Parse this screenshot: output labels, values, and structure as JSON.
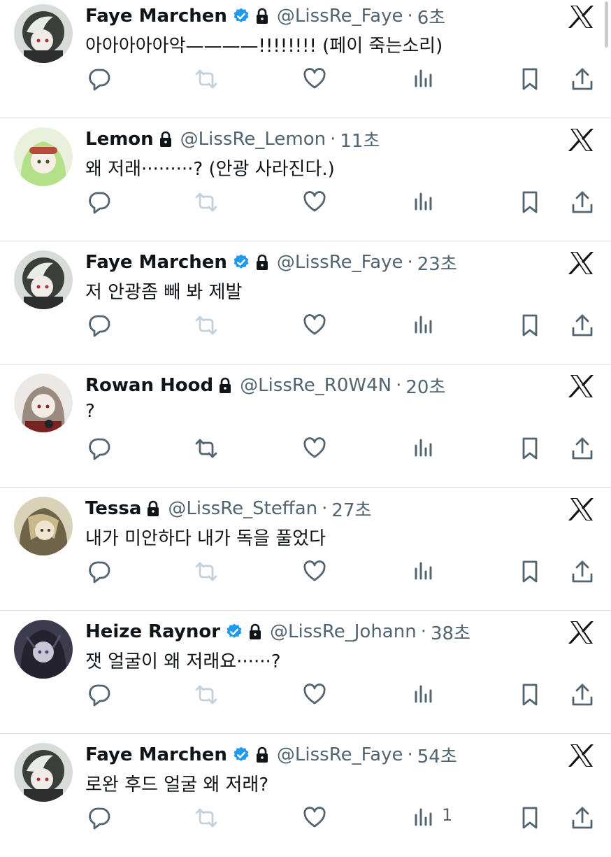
{
  "colors": {
    "verified": "#1d9bf0",
    "muted": "#536471",
    "text": "#0f1419",
    "disabled_icon": "#c6d0d8",
    "divider": "#dcdfe2"
  },
  "icons": {
    "reply": "reply-icon",
    "retweet": "retweet-icon",
    "like": "heart-icon",
    "views": "views-icon",
    "bookmark": "bookmark-icon",
    "share": "share-icon",
    "platform": "x-logo-icon",
    "lock": "lock-icon",
    "verified": "verified-badge-icon"
  },
  "tweets": [
    {
      "name": "Faye Marchen",
      "verified": true,
      "locked": true,
      "handle": "@LissRe_Faye",
      "time": "6초",
      "text": "아아아아아악————!!!!!!!! (페이 죽는소리)",
      "retweet_enabled": false,
      "views": ""
    },
    {
      "name": "Lemon",
      "verified": false,
      "locked": true,
      "handle": "@LissRe_Lemon",
      "time": "11초",
      "text": "왜 저래·········? (안광 사라진다.)",
      "retweet_enabled": false,
      "views": ""
    },
    {
      "name": "Faye Marchen",
      "verified": true,
      "locked": true,
      "handle": "@LissRe_Faye",
      "time": "23초",
      "text": "저 안광좀 빼 봐 제발",
      "retweet_enabled": false,
      "views": ""
    },
    {
      "name": "Rowan Hood",
      "verified": false,
      "locked": true,
      "handle": "@LissRe_R0W4N",
      "time": "20초",
      "text": "?",
      "retweet_enabled": true,
      "views": ""
    },
    {
      "name": "Tessa",
      "verified": false,
      "locked": true,
      "handle": "@LissRe_Steffan",
      "time": "27초",
      "text": "내가 미안하다 내가 독을 풀었다",
      "retweet_enabled": false,
      "views": ""
    },
    {
      "name": "Heize Raynor",
      "verified": true,
      "locked": true,
      "handle": "@LissRe_Johann",
      "time": "38초",
      "text": "잿 얼굴이 왜 저래요······?",
      "retweet_enabled": false,
      "views": ""
    },
    {
      "name": "Faye Marchen",
      "verified": true,
      "locked": true,
      "handle": "@LissRe_Faye",
      "time": "54초",
      "text": "로완 후드 얼굴 왜 저래?",
      "retweet_enabled": false,
      "views": "1"
    }
  ]
}
